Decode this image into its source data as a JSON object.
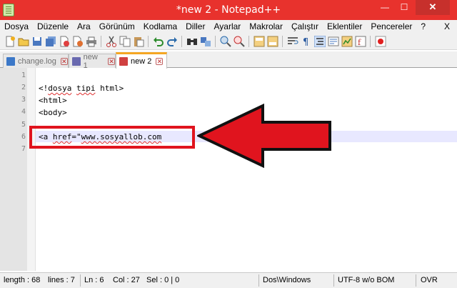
{
  "window": {
    "title": "*new  2 - Notepad++",
    "min_label": "—",
    "max_label": "☐",
    "close_label": "✕"
  },
  "menu": {
    "items": [
      "Dosya",
      "Düzenle",
      "Ara",
      "Görünüm",
      "Kodlama",
      "Diller",
      "Ayarlar",
      "Makrolar",
      "Çalıştır",
      "Eklentiler",
      "Pencereler",
      "?"
    ],
    "close_label": "X"
  },
  "tabs": [
    {
      "label": "change.log",
      "icon": "saved-file-icon",
      "color": "#3c78c8"
    },
    {
      "label": "new  1",
      "icon": "saved-file-icon",
      "color": "#6a6ab0"
    },
    {
      "label": "new  2",
      "icon": "unsaved-file-icon",
      "color": "#d04040"
    }
  ],
  "editor": {
    "line_numbers": [
      "1",
      "2",
      "3",
      "4",
      "5",
      "6",
      "7"
    ],
    "lines": [
      "",
      "<!dosya tipi html>",
      "<html>",
      "<body>",
      "",
      "<a href=\"www.sosyallob.com",
      ""
    ],
    "current_line": 6
  },
  "statusbar": {
    "length": "length : 68",
    "lines": "lines : 7",
    "ln": "Ln : 6",
    "col": "Col : 27",
    "sel": "Sel : 0 | 0",
    "eol": "Dos\\Windows",
    "encoding": "UTF-8 w/o BOM",
    "mode": "OVR"
  },
  "colors": {
    "titlebar": "#e8322d",
    "annotation": "#e0141e",
    "active_tab_accent": "#f5a623"
  }
}
